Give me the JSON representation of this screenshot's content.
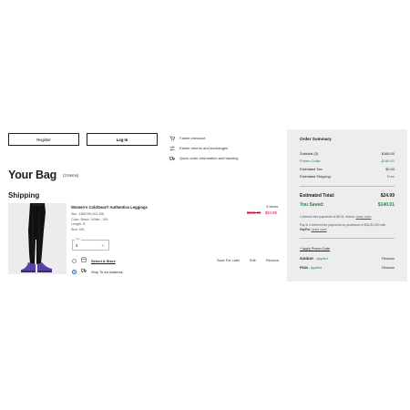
{
  "account": {
    "register_label": "Register",
    "login_label": "Log In"
  },
  "benefits": [
    {
      "icon": "cart-icon",
      "label": "Faster checkout"
    },
    {
      "icon": "exchange-icon",
      "label": "Easier returns and exchanges"
    },
    {
      "icon": "truck-icon",
      "label": "Quick order information and tracking"
    }
  ],
  "bag": {
    "title": "Your Bag",
    "count": "(3 Items)"
  },
  "shipping": {
    "title": "Shipping"
  },
  "item": {
    "name": "Women's ColdGear® Authentics Leggings",
    "sku": "Sku: 1368799-001-MD",
    "color": "Color: Black / White - 001",
    "length": "Length: R",
    "size": "Size: MD",
    "qty_label": "Qty",
    "qty_value": "3",
    "count": "3 Items",
    "price_original": "$165.00",
    "price_sale": "$24.99",
    "store_option": "Select A Store",
    "ship_option": "Ship To An Address",
    "save_later": "Save For Later",
    "edit": "Edit",
    "remove": "Remove"
  },
  "summary": {
    "title": "Order Summary",
    "rows": [
      {
        "label": "Subtotal (3)",
        "value": "$165.00"
      },
      {
        "label": "Promo Code:",
        "value": "-$140.01"
      },
      {
        "label": "Estimated Tax:",
        "value": "$0.00"
      },
      {
        "label": "Estimated Shipping:",
        "value": "Free"
      }
    ],
    "total_label": "Estimated Total:",
    "total_value": "$24.99",
    "saved_label": "You Saved:",
    "saved_value": "$140.01",
    "installments_text": "4 interest-free payments of $6.24. Klarna.",
    "learn_more": "Learn more",
    "paypal_text": "Pay in 4 interest-free payments on purchases of $30-$1,500 with",
    "paypal_brand": "PayPal",
    "paypal_learn": "Learn more",
    "apply_promo": "+ Apply Promo Code",
    "promos": [
      {
        "code": "SUNDAY",
        "status": "- Applied",
        "action": "Remove"
      },
      {
        "code": "FS34",
        "status": "- Applied",
        "action": "Remove"
      }
    ]
  },
  "colors": {
    "sale_red": "#e0002a",
    "green": "#1a8a3a",
    "panel_gray": "#ededed"
  }
}
